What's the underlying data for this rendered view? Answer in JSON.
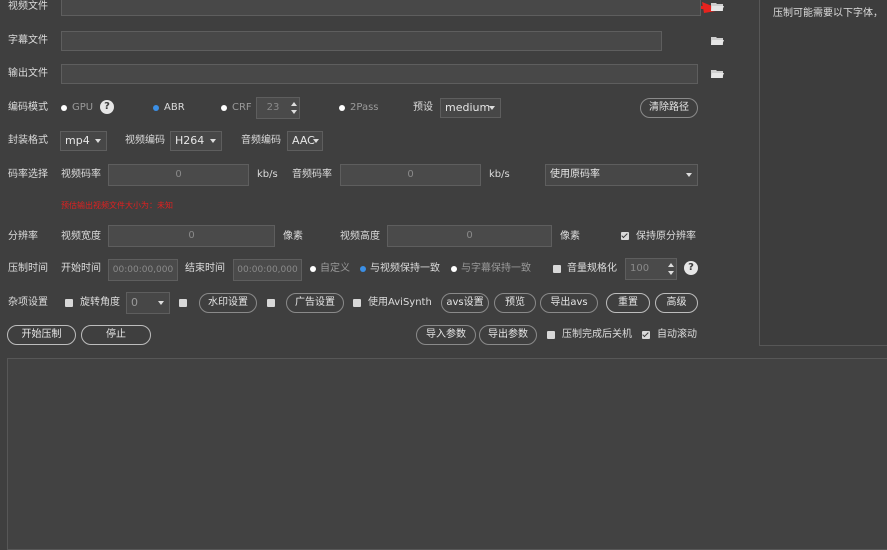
{
  "rows": {
    "video_file": {
      "label": "视频文件",
      "value": ""
    },
    "subtitle_file": {
      "label": "字幕文件",
      "value": ""
    },
    "output_file": {
      "label": "输出文件",
      "value": ""
    }
  },
  "encode_mode": {
    "label": "编码模式",
    "gpu": "GPU",
    "abr": "ABR",
    "crf": "CRF",
    "crf_value": "23",
    "pass2": "2Pass",
    "preset_label": "预设",
    "preset_value": "medium",
    "clear_path": "清除路径"
  },
  "container": {
    "label": "封装格式",
    "format_value": "mp4",
    "video_codec_label": "视频编码",
    "video_codec_value": "H264",
    "audio_codec_label": "音频编码",
    "audio_codec_value": "AAC"
  },
  "bitrate": {
    "label": "码率选择",
    "video_label": "视频码率",
    "video_value": "0",
    "video_unit": "kb/s",
    "audio_label": "音频码率",
    "audio_value": "0",
    "audio_unit": "kb/s",
    "audio_mode_value": "使用原码率",
    "warning": "预估输出视频文件大小为：未知"
  },
  "resolution": {
    "label": "分辨率",
    "width_label": "视频宽度",
    "width_value": "0",
    "width_unit": "像素",
    "height_label": "视频高度",
    "height_value": "0",
    "height_unit": "像素",
    "keep_label": "保持原分辨率"
  },
  "time": {
    "label": "压制时间",
    "start_label": "开始时间",
    "start_value": "00:00:00,000",
    "end_label": "结束时间",
    "end_value": "00:00:00,000",
    "custom": "自定义",
    "same_as_video": "与视频保持一致",
    "same_as_subtitle": "与字幕保持一致",
    "volume_label": "音量规格化",
    "volume_value": "100"
  },
  "misc": {
    "label": "杂项设置",
    "rotate_label": "旋转角度",
    "rotate_value": "0",
    "watermark": "水印设置",
    "ads": "广告设置",
    "use_avisynth": "使用AviSynth",
    "avs_settings": "avs设置",
    "preview": "预览",
    "export_avs": "导出avs",
    "reset": "重置",
    "advanced": "高级"
  },
  "actions": {
    "start": "开始压制",
    "stop": "停止",
    "import_params": "导入参数",
    "export_params": "导出参数",
    "shutdown_after": "压制完成后关机",
    "auto_scroll": "自动滚动"
  },
  "right_panel": {
    "text": "压制可能需要以下字体，"
  },
  "colors": {
    "accent_blue": "#3b8fe5",
    "warning_red": "#e02020",
    "arrow_red": "#e8231e"
  }
}
